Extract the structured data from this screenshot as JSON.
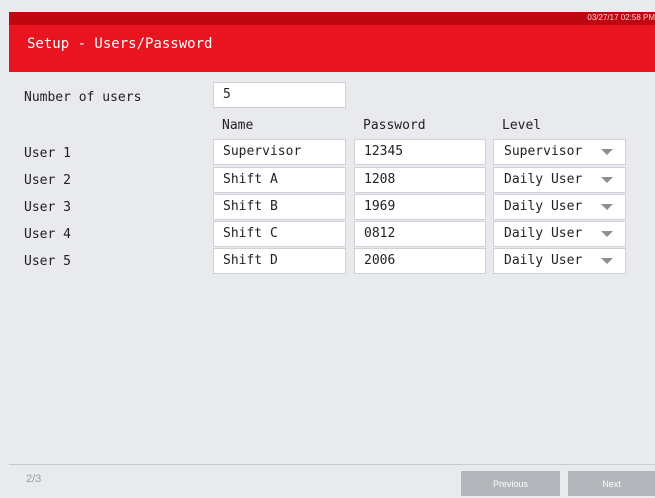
{
  "header": {
    "timestamp": "03/27/17 02:58 PM",
    "title": "Setup - Users/Password"
  },
  "number_of_users": {
    "label": "Number of users",
    "value": "5"
  },
  "columns": {
    "name": "Name",
    "password": "Password",
    "level": "Level"
  },
  "users": [
    {
      "label": "User 1",
      "name": "Supervisor",
      "password": "12345",
      "level": "Supervisor"
    },
    {
      "label": "User 2",
      "name": "Shift A",
      "password": "1208",
      "level": "Daily User"
    },
    {
      "label": "User 3",
      "name": "Shift B",
      "password": "1969",
      "level": "Daily User"
    },
    {
      "label": "User 4",
      "name": "Shift C",
      "password": "0812",
      "level": "Daily User"
    },
    {
      "label": "User 5",
      "name": "Shift D",
      "password": "2006",
      "level": "Daily User"
    }
  ],
  "footer": {
    "page": "2/3",
    "previous_label": "Previous",
    "next_label": "Next"
  },
  "colors": {
    "header_red": "#e8141f",
    "header_strip": "#bf0712",
    "background": "#e9eaee",
    "button_gray": "#b3b6bb"
  }
}
